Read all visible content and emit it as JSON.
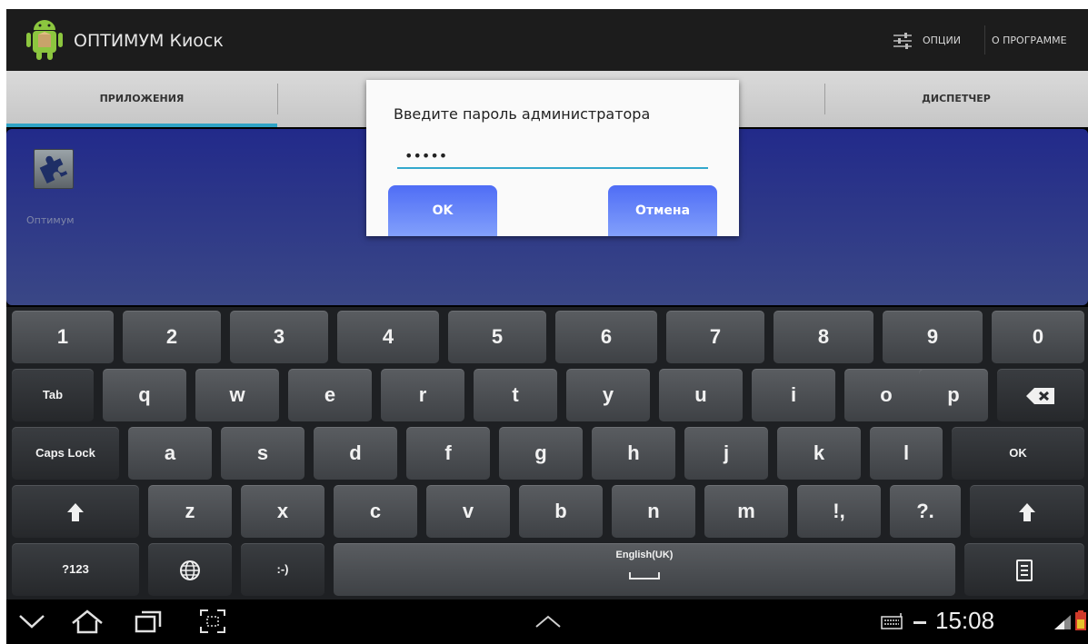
{
  "app": {
    "title": "ОПТИМУМ Киоск",
    "options_label": "ОПЦИИ",
    "about_label": "О ПРОГРАММЕ"
  },
  "tabs": [
    {
      "label": "ПРИЛОЖЕНИЯ",
      "active": true
    },
    {
      "label": "ДИСПЕТЧЕР",
      "active": false
    }
  ],
  "launcher": {
    "items": [
      {
        "label": "Оптимум",
        "icon": "puzzle-icon"
      }
    ]
  },
  "dialog": {
    "title": "Введите пароль администратора",
    "password_value": "•••••",
    "ok_label": "OK",
    "cancel_label": "Отмена"
  },
  "keyboard": {
    "row1": [
      "1",
      "2",
      "3",
      "4",
      "5",
      "6",
      "7",
      "8",
      "9",
      "0"
    ],
    "row2": [
      "q",
      "w",
      "e",
      "r",
      "t",
      "y",
      "u",
      "i",
      "o",
      "p"
    ],
    "row3": [
      "a",
      "s",
      "d",
      "f",
      "g",
      "h",
      "j",
      "k",
      "l"
    ],
    "row4": [
      "z",
      "x",
      "c",
      "v",
      "b",
      "n",
      "m",
      "!,",
      "?."
    ],
    "tab_label": "Tab",
    "caps_label": "Caps Lock",
    "enter_label": "OK",
    "symbols_label": "?123",
    "emoticon_label": ":-)",
    "space_label": "English(UK)"
  },
  "status": {
    "time": "15:08"
  }
}
